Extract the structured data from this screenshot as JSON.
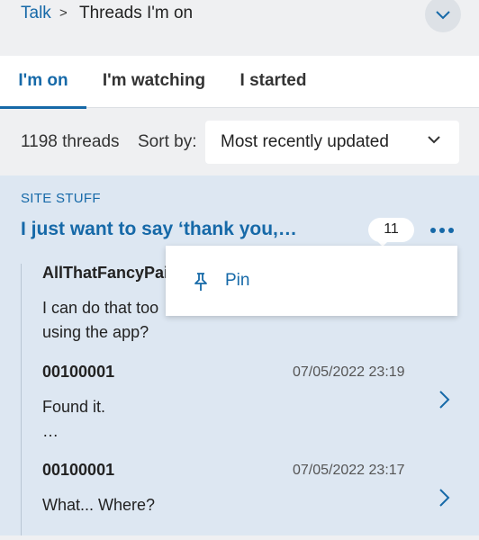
{
  "breadcrumb": {
    "link": "Talk",
    "separator": ">",
    "current": "Threads I'm on"
  },
  "tabs": [
    {
      "label": "I'm on",
      "active": true
    },
    {
      "label": "I'm watching",
      "active": false
    },
    {
      "label": "I started",
      "active": false
    }
  ],
  "filter": {
    "count": "1198 threads",
    "sort_label": "Sort by:",
    "sort_value": "Most recently updated"
  },
  "thread": {
    "category": "SITE STUFF",
    "title": "I just want to say ‘thank you,…",
    "reply_count": "11",
    "replies": [
      {
        "author": "AllThatFancyPai",
        "time": "",
        "body": "I can do that too",
        "body2": "using the app?"
      },
      {
        "author": "00100001",
        "time": "07/05/2022 23:19",
        "body": "Found it.",
        "body2": "…"
      },
      {
        "author": "00100001",
        "time": "07/05/2022 23:17",
        "body": "What... Where?",
        "body2": ""
      }
    ]
  },
  "menu": {
    "pin_label": "Pin"
  },
  "colors": {
    "accent": "#1669a8",
    "card_bg": "#dde7f2",
    "page_bg": "#eff0f2"
  },
  "icons": {
    "collapse": "chevron-down-icon",
    "sort": "chevron-down-icon",
    "more": "more-dots-icon",
    "pin": "pin-icon",
    "reply": "chevron-right-icon"
  }
}
